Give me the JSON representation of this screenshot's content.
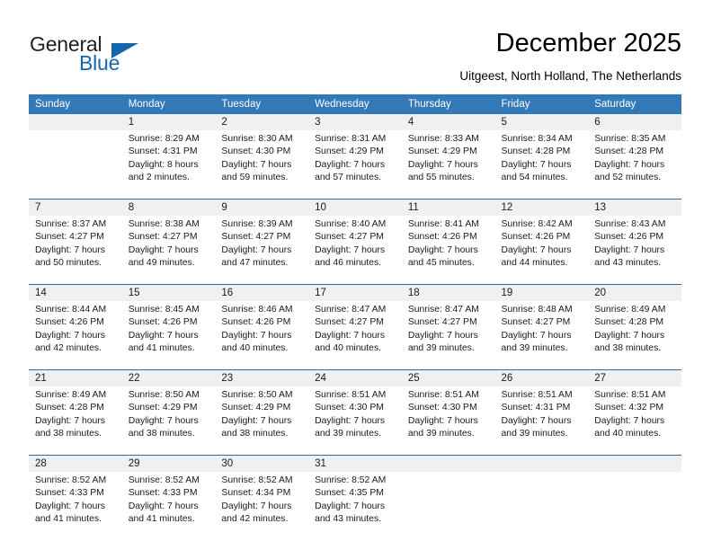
{
  "logo": {
    "word1": "General",
    "word2": "Blue",
    "triangle_color": "#1566ad"
  },
  "header": {
    "title": "December 2025",
    "subtitle": "Uitgeest, North Holland, The Netherlands",
    "header_bg": "#3379b8",
    "separator_color": "#2a6aa8",
    "daynum_bg": "#f0f0f0"
  },
  "weekdays": [
    "Sunday",
    "Monday",
    "Tuesday",
    "Wednesday",
    "Thursday",
    "Friday",
    "Saturday"
  ],
  "weeks": [
    [
      {
        "day": "",
        "l1": "",
        "l2": "",
        "l3": "",
        "l4": ""
      },
      {
        "day": "1",
        "l1": "Sunrise: 8:29 AM",
        "l2": "Sunset: 4:31 PM",
        "l3": "Daylight: 8 hours",
        "l4": "and 2 minutes."
      },
      {
        "day": "2",
        "l1": "Sunrise: 8:30 AM",
        "l2": "Sunset: 4:30 PM",
        "l3": "Daylight: 7 hours",
        "l4": "and 59 minutes."
      },
      {
        "day": "3",
        "l1": "Sunrise: 8:31 AM",
        "l2": "Sunset: 4:29 PM",
        "l3": "Daylight: 7 hours",
        "l4": "and 57 minutes."
      },
      {
        "day": "4",
        "l1": "Sunrise: 8:33 AM",
        "l2": "Sunset: 4:29 PM",
        "l3": "Daylight: 7 hours",
        "l4": "and 55 minutes."
      },
      {
        "day": "5",
        "l1": "Sunrise: 8:34 AM",
        "l2": "Sunset: 4:28 PM",
        "l3": "Daylight: 7 hours",
        "l4": "and 54 minutes."
      },
      {
        "day": "6",
        "l1": "Sunrise: 8:35 AM",
        "l2": "Sunset: 4:28 PM",
        "l3": "Daylight: 7 hours",
        "l4": "and 52 minutes."
      }
    ],
    [
      {
        "day": "7",
        "l1": "Sunrise: 8:37 AM",
        "l2": "Sunset: 4:27 PM",
        "l3": "Daylight: 7 hours",
        "l4": "and 50 minutes."
      },
      {
        "day": "8",
        "l1": "Sunrise: 8:38 AM",
        "l2": "Sunset: 4:27 PM",
        "l3": "Daylight: 7 hours",
        "l4": "and 49 minutes."
      },
      {
        "day": "9",
        "l1": "Sunrise: 8:39 AM",
        "l2": "Sunset: 4:27 PM",
        "l3": "Daylight: 7 hours",
        "l4": "and 47 minutes."
      },
      {
        "day": "10",
        "l1": "Sunrise: 8:40 AM",
        "l2": "Sunset: 4:27 PM",
        "l3": "Daylight: 7 hours",
        "l4": "and 46 minutes."
      },
      {
        "day": "11",
        "l1": "Sunrise: 8:41 AM",
        "l2": "Sunset: 4:26 PM",
        "l3": "Daylight: 7 hours",
        "l4": "and 45 minutes."
      },
      {
        "day": "12",
        "l1": "Sunrise: 8:42 AM",
        "l2": "Sunset: 4:26 PM",
        "l3": "Daylight: 7 hours",
        "l4": "and 44 minutes."
      },
      {
        "day": "13",
        "l1": "Sunrise: 8:43 AM",
        "l2": "Sunset: 4:26 PM",
        "l3": "Daylight: 7 hours",
        "l4": "and 43 minutes."
      }
    ],
    [
      {
        "day": "14",
        "l1": "Sunrise: 8:44 AM",
        "l2": "Sunset: 4:26 PM",
        "l3": "Daylight: 7 hours",
        "l4": "and 42 minutes."
      },
      {
        "day": "15",
        "l1": "Sunrise: 8:45 AM",
        "l2": "Sunset: 4:26 PM",
        "l3": "Daylight: 7 hours",
        "l4": "and 41 minutes."
      },
      {
        "day": "16",
        "l1": "Sunrise: 8:46 AM",
        "l2": "Sunset: 4:26 PM",
        "l3": "Daylight: 7 hours",
        "l4": "and 40 minutes."
      },
      {
        "day": "17",
        "l1": "Sunrise: 8:47 AM",
        "l2": "Sunset: 4:27 PM",
        "l3": "Daylight: 7 hours",
        "l4": "and 40 minutes."
      },
      {
        "day": "18",
        "l1": "Sunrise: 8:47 AM",
        "l2": "Sunset: 4:27 PM",
        "l3": "Daylight: 7 hours",
        "l4": "and 39 minutes."
      },
      {
        "day": "19",
        "l1": "Sunrise: 8:48 AM",
        "l2": "Sunset: 4:27 PM",
        "l3": "Daylight: 7 hours",
        "l4": "and 39 minutes."
      },
      {
        "day": "20",
        "l1": "Sunrise: 8:49 AM",
        "l2": "Sunset: 4:28 PM",
        "l3": "Daylight: 7 hours",
        "l4": "and 38 minutes."
      }
    ],
    [
      {
        "day": "21",
        "l1": "Sunrise: 8:49 AM",
        "l2": "Sunset: 4:28 PM",
        "l3": "Daylight: 7 hours",
        "l4": "and 38 minutes."
      },
      {
        "day": "22",
        "l1": "Sunrise: 8:50 AM",
        "l2": "Sunset: 4:29 PM",
        "l3": "Daylight: 7 hours",
        "l4": "and 38 minutes."
      },
      {
        "day": "23",
        "l1": "Sunrise: 8:50 AM",
        "l2": "Sunset: 4:29 PM",
        "l3": "Daylight: 7 hours",
        "l4": "and 38 minutes."
      },
      {
        "day": "24",
        "l1": "Sunrise: 8:51 AM",
        "l2": "Sunset: 4:30 PM",
        "l3": "Daylight: 7 hours",
        "l4": "and 39 minutes."
      },
      {
        "day": "25",
        "l1": "Sunrise: 8:51 AM",
        "l2": "Sunset: 4:30 PM",
        "l3": "Daylight: 7 hours",
        "l4": "and 39 minutes."
      },
      {
        "day": "26",
        "l1": "Sunrise: 8:51 AM",
        "l2": "Sunset: 4:31 PM",
        "l3": "Daylight: 7 hours",
        "l4": "and 39 minutes."
      },
      {
        "day": "27",
        "l1": "Sunrise: 8:51 AM",
        "l2": "Sunset: 4:32 PM",
        "l3": "Daylight: 7 hours",
        "l4": "and 40 minutes."
      }
    ],
    [
      {
        "day": "28",
        "l1": "Sunrise: 8:52 AM",
        "l2": "Sunset: 4:33 PM",
        "l3": "Daylight: 7 hours",
        "l4": "and 41 minutes."
      },
      {
        "day": "29",
        "l1": "Sunrise: 8:52 AM",
        "l2": "Sunset: 4:33 PM",
        "l3": "Daylight: 7 hours",
        "l4": "and 41 minutes."
      },
      {
        "day": "30",
        "l1": "Sunrise: 8:52 AM",
        "l2": "Sunset: 4:34 PM",
        "l3": "Daylight: 7 hours",
        "l4": "and 42 minutes."
      },
      {
        "day": "31",
        "l1": "Sunrise: 8:52 AM",
        "l2": "Sunset: 4:35 PM",
        "l3": "Daylight: 7 hours",
        "l4": "and 43 minutes."
      },
      {
        "day": "",
        "l1": "",
        "l2": "",
        "l3": "",
        "l4": ""
      },
      {
        "day": "",
        "l1": "",
        "l2": "",
        "l3": "",
        "l4": ""
      },
      {
        "day": "",
        "l1": "",
        "l2": "",
        "l3": "",
        "l4": ""
      }
    ]
  ]
}
